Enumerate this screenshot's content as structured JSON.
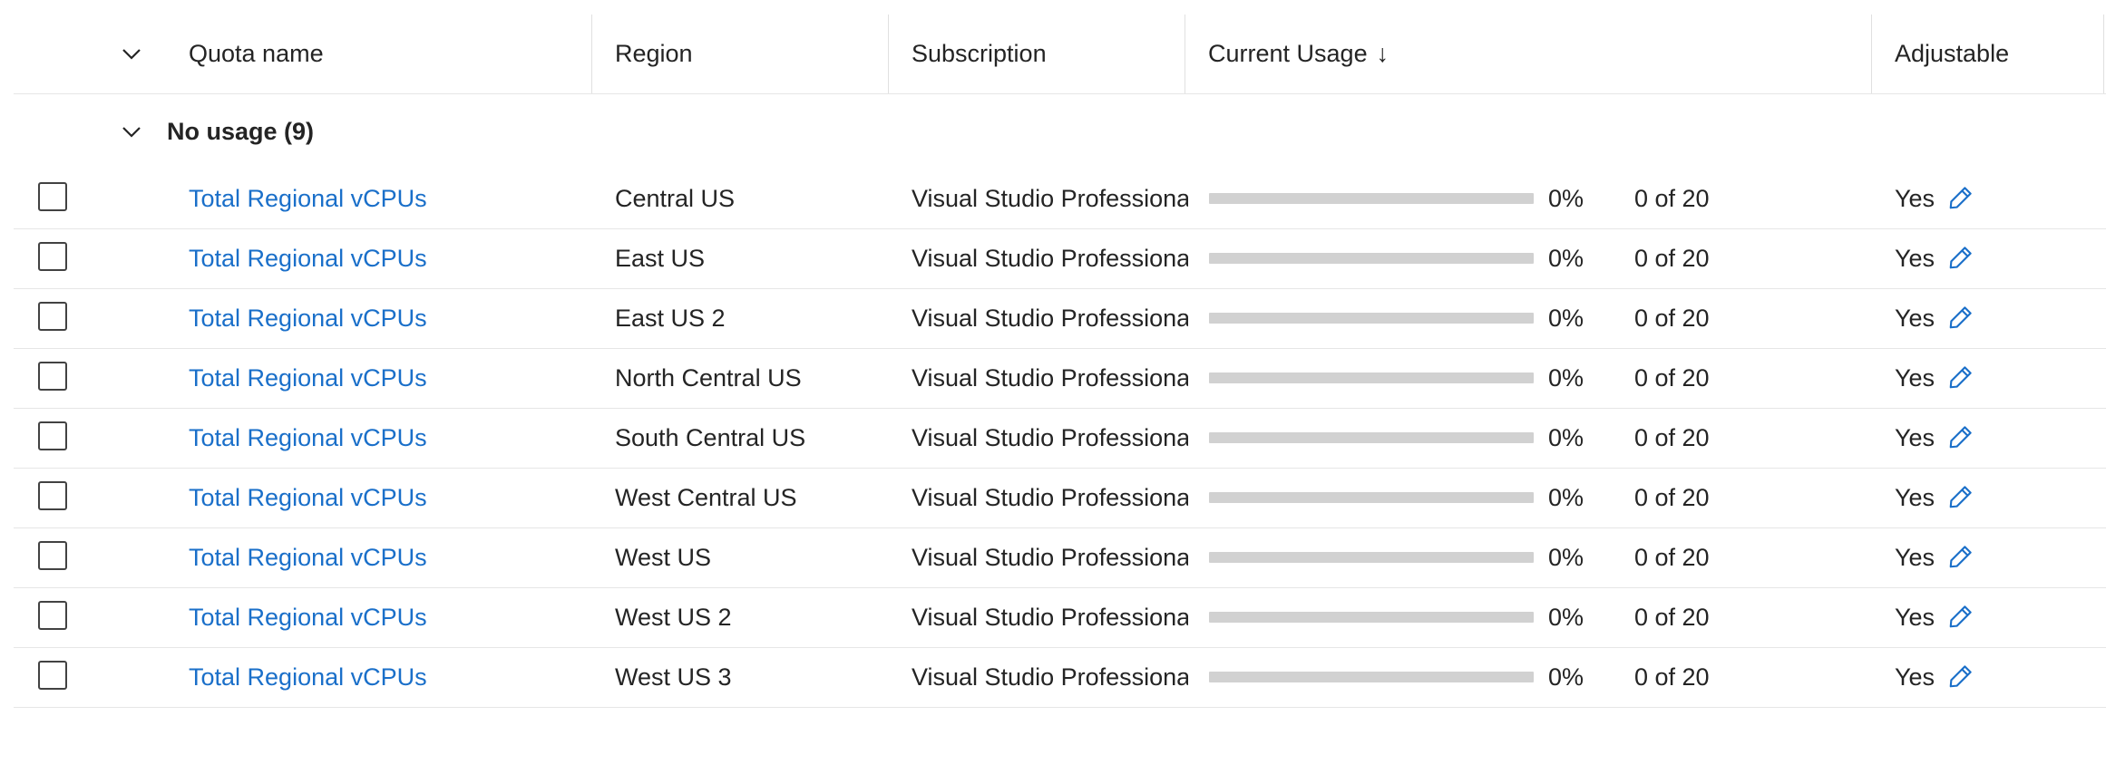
{
  "colors": {
    "link": "#1a6fc9",
    "bar_track": "#d1d1d1",
    "bar_fill": "#0f6cbd",
    "divider": "#e6e6e6",
    "text": "#242424"
  },
  "header": {
    "expand_icon": "chevron-down-icon",
    "columns": {
      "quota_name": "Quota name",
      "region": "Region",
      "subscription": "Subscription",
      "current_usage": "Current Usage",
      "adjustable": "Adjustable"
    },
    "sort_indicator": "↓",
    "sort_icon": "arrow-down-icon"
  },
  "group": {
    "label": "No usage (9)",
    "expanded": true,
    "icon": "chevron-down-icon"
  },
  "rows": [
    {
      "quota_name": "Total Regional vCPUs",
      "region": "Central US",
      "subscription": "Visual Studio Professional",
      "usage_fraction": 0,
      "percent": "0%",
      "usage": "0 of 20",
      "adjustable": "Yes"
    },
    {
      "quota_name": "Total Regional vCPUs",
      "region": "East US",
      "subscription": "Visual Studio Professional",
      "usage_fraction": 0,
      "percent": "0%",
      "usage": "0 of 20",
      "adjustable": "Yes"
    },
    {
      "quota_name": "Total Regional vCPUs",
      "region": "East US 2",
      "subscription": "Visual Studio Professional",
      "usage_fraction": 0,
      "percent": "0%",
      "usage": "0 of 20",
      "adjustable": "Yes"
    },
    {
      "quota_name": "Total Regional vCPUs",
      "region": "North Central US",
      "subscription": "Visual Studio Professional",
      "usage_fraction": 0,
      "percent": "0%",
      "usage": "0 of 20",
      "adjustable": "Yes"
    },
    {
      "quota_name": "Total Regional vCPUs",
      "region": "South Central US",
      "subscription": "Visual Studio Professional",
      "usage_fraction": 0,
      "percent": "0%",
      "usage": "0 of 20",
      "adjustable": "Yes"
    },
    {
      "quota_name": "Total Regional vCPUs",
      "region": "West Central US",
      "subscription": "Visual Studio Professional",
      "usage_fraction": 0,
      "percent": "0%",
      "usage": "0 of 20",
      "adjustable": "Yes"
    },
    {
      "quota_name": "Total Regional vCPUs",
      "region": "West US",
      "subscription": "Visual Studio Professional",
      "usage_fraction": 0,
      "percent": "0%",
      "usage": "0 of 20",
      "adjustable": "Yes"
    },
    {
      "quota_name": "Total Regional vCPUs",
      "region": "West US 2",
      "subscription": "Visual Studio Professional",
      "usage_fraction": 0,
      "percent": "0%",
      "usage": "0 of 20",
      "adjustable": "Yes"
    },
    {
      "quota_name": "Total Regional vCPUs",
      "region": "West US 3",
      "subscription": "Visual Studio Professional",
      "usage_fraction": 0,
      "percent": "0%",
      "usage": "0 of 20",
      "adjustable": "Yes"
    }
  ],
  "row_icons": {
    "select": "checkbox-icon",
    "edit": "pencil-icon"
  }
}
